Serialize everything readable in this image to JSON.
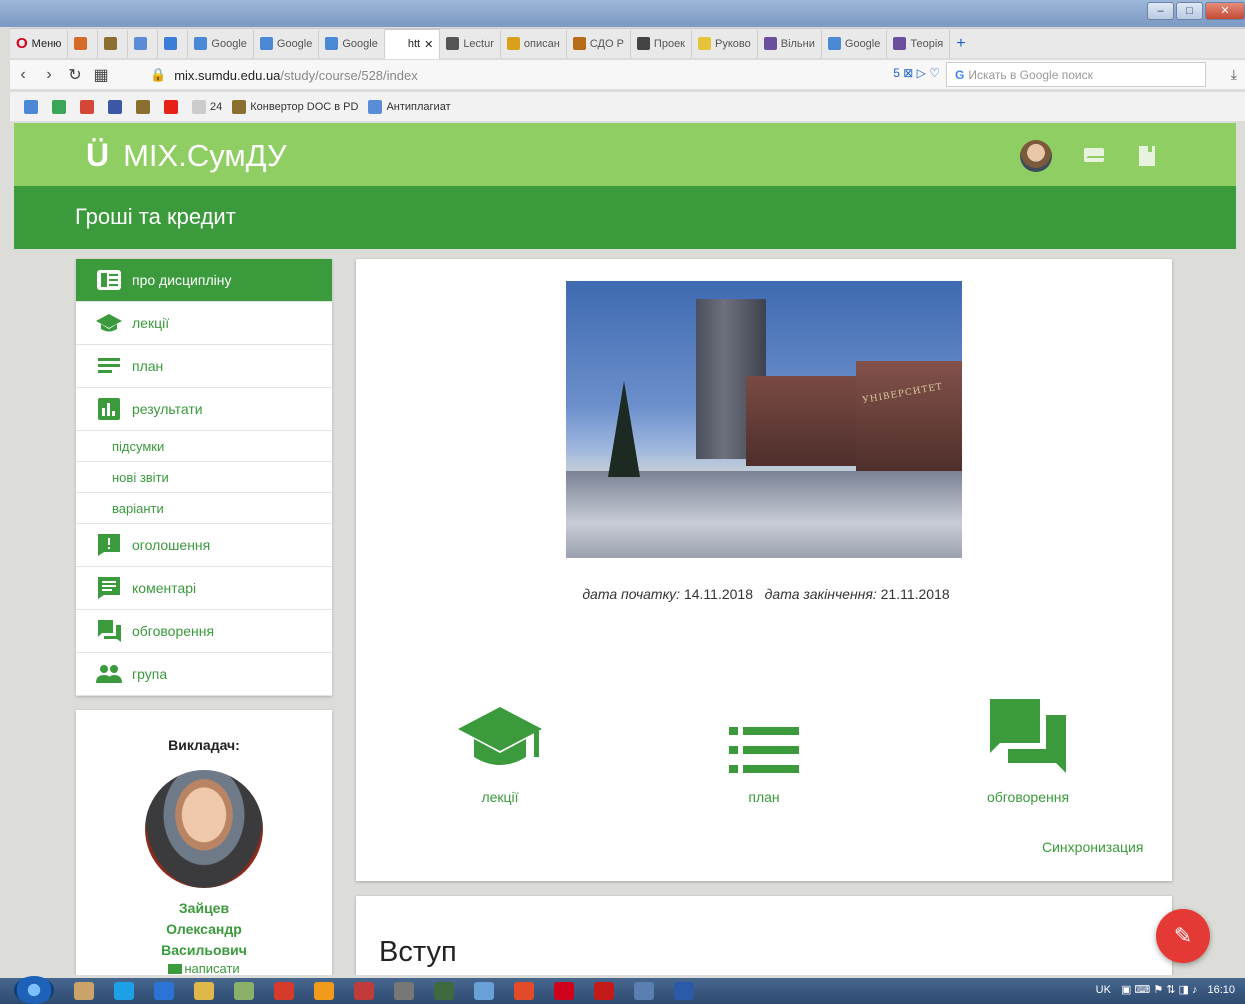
{
  "browser": {
    "menu_label": "Меню",
    "tabs": [
      {
        "label": "",
        "color": "#d36b2a"
      },
      {
        "label": "",
        "color": "#8b6f2e"
      },
      {
        "label": "",
        "color": "#5b8dd6"
      },
      {
        "label": "",
        "color": "#3c7dd9"
      },
      {
        "label": "Google",
        "color": "#4b88d6"
      },
      {
        "label": "Google",
        "color": "#4b88d6"
      },
      {
        "label": "Google",
        "color": "#4b88d6"
      },
      {
        "label": "htt",
        "color": "#ffffff",
        "active": true
      },
      {
        "label": "Lectur",
        "color": "#555555"
      },
      {
        "label": "описан",
        "color": "#d9a11b"
      },
      {
        "label": "СДО Р",
        "color": "#b56b17"
      },
      {
        "label": "Проек",
        "color": "#444444"
      },
      {
        "label": "Руково",
        "color": "#e7c33c"
      },
      {
        "label": "Вільни",
        "color": "#6b4e9b"
      },
      {
        "label": "Google",
        "color": "#4b88d6"
      },
      {
        "label": "Теорія",
        "color": "#6b4e9b"
      }
    ],
    "url_domain": "mix.sumdu.edu.ua",
    "url_path": "/study/course/528/index",
    "url_badge": "5",
    "search_placeholder": "Искать в Google поиск",
    "bookmarks": [
      {
        "label": "",
        "color": "#4b88d6"
      },
      {
        "label": "",
        "color": "#3aa657"
      },
      {
        "label": "",
        "color": "#d44638"
      },
      {
        "label": "",
        "color": "#3c57a6"
      },
      {
        "label": "",
        "color": "#8b6f2e"
      },
      {
        "label": "",
        "color": "#e62117"
      },
      {
        "label": "24",
        "color": "#cccccc"
      },
      {
        "label": "Конвертор DOC в PD",
        "color": "#8b6f2e"
      },
      {
        "label": "Антиплагиат",
        "color": "#5b8dd6"
      }
    ]
  },
  "header": {
    "logo_text": "MIX.СумДУ",
    "course_title": "Гроші та кредит"
  },
  "sidebar": {
    "items": [
      {
        "label": "про дисципліну",
        "icon": "info-icon",
        "active": true
      },
      {
        "label": "лекції",
        "icon": "graduation-cap-icon"
      },
      {
        "label": "план",
        "icon": "plan-lines-icon"
      },
      {
        "label": "результати",
        "icon": "bar-chart-icon"
      }
    ],
    "sub_items": [
      "підсумки",
      "нові звіти",
      "варіанти"
    ],
    "items2": [
      {
        "label": "оголошення",
        "icon": "announcement-icon"
      },
      {
        "label": "коментарі",
        "icon": "comment-icon"
      },
      {
        "label": "обговорення",
        "icon": "forum-icon"
      },
      {
        "label": "група",
        "icon": "group-icon"
      }
    ]
  },
  "teacher": {
    "label": "Викладач:",
    "name_line1": "Зайцев",
    "name_line2": "Олександр",
    "name_line3": "Васильович",
    "write": "написати"
  },
  "course": {
    "photo_sign": "УНІВЕРСИТЕТ",
    "start_label": "дата початку:",
    "start_date": "14.11.2018",
    "end_label": "дата закінчення:",
    "end_date": "21.11.2018",
    "quick_links": [
      {
        "label": "лекції",
        "icon": "graduation-cap-icon"
      },
      {
        "label": "план",
        "icon": "plan-lines-icon"
      },
      {
        "label": "обговорення",
        "icon": "forum-icon"
      }
    ],
    "sync_label": "Синхронизация",
    "intro_heading": "Вступ"
  },
  "taskbar": {
    "lang": "UK",
    "time": "16:10"
  },
  "colors": {
    "green_light": "#8fce63",
    "green_dark": "#3a9a3c",
    "fab_red": "#e53935"
  }
}
